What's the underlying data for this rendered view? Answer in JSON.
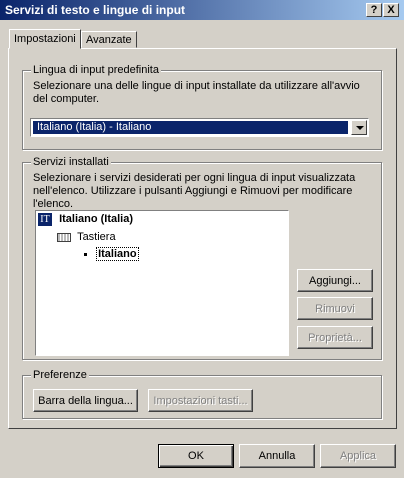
{
  "window": {
    "title": "Servizi di testo e lingue di input",
    "help_glyph": "?",
    "close_glyph": "X"
  },
  "tabs": [
    {
      "label": "Impostazioni"
    },
    {
      "label": "Avanzate"
    }
  ],
  "default_lang": {
    "group_label": "Lingua di input predefinita",
    "description": "Selezionare una delle lingue di input installate da utilizzare all'avvio del computer.",
    "selected": "Italiano (Italia) - Italiano"
  },
  "installed": {
    "group_label": "Servizi installati",
    "description": "Selezionare i servizi desiderati per ogni lingua di input visualizzata nell'elenco. Utilizzare i pulsanti Aggiungi e Rimuovi per modificare l'elenco.",
    "tree": {
      "lang_code": "IT",
      "lang_name": "Italiano (Italia)",
      "category": "Tastiera",
      "layout": "Italiano"
    },
    "buttons": {
      "add": "Aggiungi...",
      "remove": "Rimuovi",
      "properties": "Proprietà..."
    }
  },
  "preferences": {
    "group_label": "Preferenze",
    "language_bar": "Barra della lingua...",
    "key_settings": "Impostazioni tasti..."
  },
  "footer": {
    "ok": "OK",
    "cancel": "Annulla",
    "apply": "Applica"
  }
}
